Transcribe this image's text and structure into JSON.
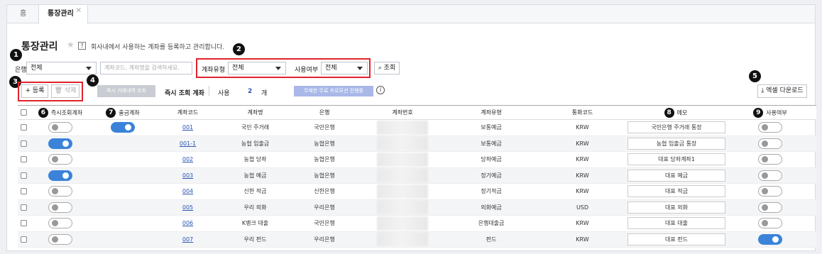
{
  "tabs": {
    "home": "홈",
    "active": "통장관리",
    "close": "×"
  },
  "header": {
    "title": "통장관리",
    "star": "★",
    "help_icon": "?",
    "description": "회사내에서 사용하는 계좌를 등록하고 관리합니다."
  },
  "filters": {
    "bank_label": "은행",
    "bank_value": "전체",
    "search_placeholder": "계좌코드, 계좌명을 검색하세요.",
    "type_label": "계좌유형",
    "type_value": "전체",
    "use_label": "사용여부",
    "use_value": "전체",
    "search_button": "조회"
  },
  "toolbar": {
    "register": "등록",
    "delete": "삭제",
    "instant_query": "즉시 거래내역 조회",
    "instant_label": "즉시 조회 계좌",
    "use_label": "사용",
    "use_count": "2",
    "use_unit": "개",
    "promo": "무제한 무료 프로모션 진행중",
    "info_icon": "i",
    "excel": "엑셀 다운로드"
  },
  "badges": [
    "1",
    "2",
    "3",
    "4",
    "5",
    "6",
    "7",
    "8",
    "9"
  ],
  "columns": [
    "즉시조회계좌",
    "출금계좌",
    "계좌코드",
    "계좌명",
    "은행",
    "계좌번호",
    "계좌유형",
    "통화코드",
    "메모",
    "사용여부"
  ],
  "rows": [
    {
      "instant": false,
      "withdraw": true,
      "code": "001",
      "name": "국민 주거래",
      "bank": "국민은행",
      "type": "보통예금",
      "currency": "KRW",
      "memo": "국민은행 주거래 통장",
      "use": false
    },
    {
      "instant": true,
      "withdraw": false,
      "code": "001-1",
      "name": "농협 입출금",
      "bank": "농협은행",
      "type": "보통예금",
      "currency": "KRW",
      "memo": "농협 입출금 통장",
      "use": false
    },
    {
      "instant": false,
      "withdraw": false,
      "code": "002",
      "name": "농협 당좌",
      "bank": "농협은행",
      "type": "당좌예금",
      "currency": "KRW",
      "memo": "대표 당좌계좌1",
      "use": false
    },
    {
      "instant": true,
      "withdraw": false,
      "code": "003",
      "name": "농협 예금",
      "bank": "농협은행",
      "type": "정기예금",
      "currency": "KRW",
      "memo": "대표 예금",
      "use": false
    },
    {
      "instant": false,
      "withdraw": false,
      "code": "004",
      "name": "신한 적금",
      "bank": "신한은행",
      "type": "정기적금",
      "currency": "KRW",
      "memo": "대표 적금",
      "use": false
    },
    {
      "instant": false,
      "withdraw": false,
      "code": "005",
      "name": "우리 외화",
      "bank": "우리은행",
      "type": "외화예금",
      "currency": "USD",
      "memo": "대표 외화",
      "use": false
    },
    {
      "instant": false,
      "withdraw": false,
      "code": "006",
      "name": "K뱅크 대출",
      "bank": "국민은행",
      "type": "은행대출금",
      "currency": "KRW",
      "memo": "대표 대출",
      "use": false
    },
    {
      "instant": false,
      "withdraw": false,
      "code": "007",
      "name": "우리 펀드",
      "bank": "우리은행",
      "type": "펀드",
      "currency": "KRW",
      "memo": "대표 펀드",
      "use": true
    }
  ]
}
